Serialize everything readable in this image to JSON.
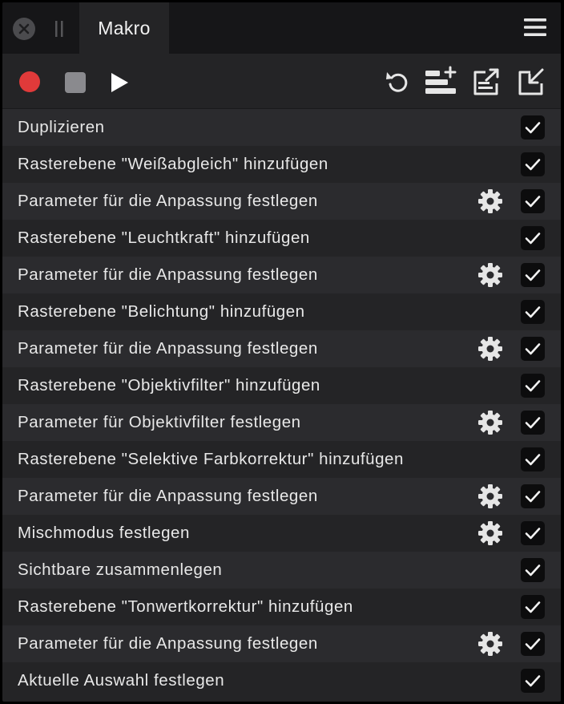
{
  "window": {
    "tab_title": "Makro",
    "icons": {
      "close": "close-icon",
      "grip": "grip-icon",
      "menu": "hamburger-menu-icon"
    }
  },
  "toolbar": {
    "buttons": [
      {
        "name": "record",
        "icon": "record-icon",
        "color": "#e03a3a"
      },
      {
        "name": "stop",
        "icon": "stop-icon",
        "color": "#8a8a8e"
      },
      {
        "name": "play",
        "icon": "play-icon",
        "color": "#ffffff"
      },
      {
        "name": "undo",
        "icon": "undo-icon"
      },
      {
        "name": "add-to-library",
        "icon": "add-list-icon"
      },
      {
        "name": "export",
        "icon": "export-icon"
      },
      {
        "name": "import",
        "icon": "import-icon"
      }
    ]
  },
  "steps": [
    {
      "label": "Duplizieren",
      "has_settings": false,
      "checked": true
    },
    {
      "label": "Rasterebene \"Weißabgleich\" hinzufügen",
      "has_settings": false,
      "checked": true
    },
    {
      "label": "Parameter für die Anpassung festlegen",
      "has_settings": true,
      "checked": true
    },
    {
      "label": "Rasterebene \"Leuchtkraft\" hinzufügen",
      "has_settings": false,
      "checked": true
    },
    {
      "label": "Parameter für die Anpassung festlegen",
      "has_settings": true,
      "checked": true
    },
    {
      "label": "Rasterebene \"Belichtung\" hinzufügen",
      "has_settings": false,
      "checked": true
    },
    {
      "label": "Parameter für die Anpassung festlegen",
      "has_settings": true,
      "checked": true
    },
    {
      "label": "Rasterebene \"Objektivfilter\" hinzufügen",
      "has_settings": false,
      "checked": true
    },
    {
      "label": "Parameter für Objektivfilter festlegen",
      "has_settings": true,
      "checked": true
    },
    {
      "label": "Rasterebene \"Selektive Farbkorrektur\" hinzufügen",
      "has_settings": false,
      "checked": true
    },
    {
      "label": "Parameter für die Anpassung festlegen",
      "has_settings": true,
      "checked": true
    },
    {
      "label": "Mischmodus festlegen",
      "has_settings": true,
      "checked": true
    },
    {
      "label": "Sichtbare zusammenlegen",
      "has_settings": false,
      "checked": true
    },
    {
      "label": "Rasterebene \"Tonwertkorrektur\" hinzufügen",
      "has_settings": false,
      "checked": true
    },
    {
      "label": "Parameter für die Anpassung festlegen",
      "has_settings": true,
      "checked": true
    },
    {
      "label": "Aktuelle Auswahl festlegen",
      "has_settings": false,
      "checked": true
    }
  ],
  "colors": {
    "panel_bg": "#242426",
    "row_alt_bg": "#2b2b2e",
    "titlebar_bg": "#161618",
    "text": "#e8e8e8",
    "checkbox_bg": "#0c0c0d"
  }
}
